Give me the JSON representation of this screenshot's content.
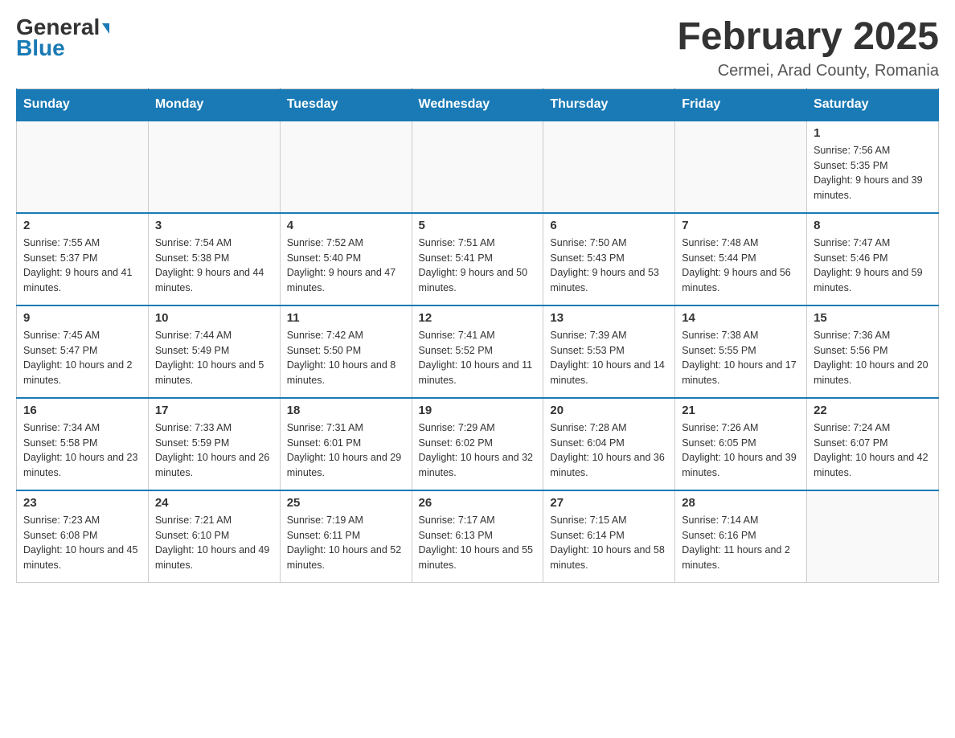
{
  "logo": {
    "general": "General",
    "blue": "Blue"
  },
  "title": {
    "month_year": "February 2025",
    "location": "Cermei, Arad County, Romania"
  },
  "days_of_week": [
    "Sunday",
    "Monday",
    "Tuesday",
    "Wednesday",
    "Thursday",
    "Friday",
    "Saturday"
  ],
  "weeks": [
    [
      {
        "day": "",
        "sunrise": "",
        "sunset": "",
        "daylight": ""
      },
      {
        "day": "",
        "sunrise": "",
        "sunset": "",
        "daylight": ""
      },
      {
        "day": "",
        "sunrise": "",
        "sunset": "",
        "daylight": ""
      },
      {
        "day": "",
        "sunrise": "",
        "sunset": "",
        "daylight": ""
      },
      {
        "day": "",
        "sunrise": "",
        "sunset": "",
        "daylight": ""
      },
      {
        "day": "",
        "sunrise": "",
        "sunset": "",
        "daylight": ""
      },
      {
        "day": "1",
        "sunrise": "Sunrise: 7:56 AM",
        "sunset": "Sunset: 5:35 PM",
        "daylight": "Daylight: 9 hours and 39 minutes."
      }
    ],
    [
      {
        "day": "2",
        "sunrise": "Sunrise: 7:55 AM",
        "sunset": "Sunset: 5:37 PM",
        "daylight": "Daylight: 9 hours and 41 minutes."
      },
      {
        "day": "3",
        "sunrise": "Sunrise: 7:54 AM",
        "sunset": "Sunset: 5:38 PM",
        "daylight": "Daylight: 9 hours and 44 minutes."
      },
      {
        "day": "4",
        "sunrise": "Sunrise: 7:52 AM",
        "sunset": "Sunset: 5:40 PM",
        "daylight": "Daylight: 9 hours and 47 minutes."
      },
      {
        "day": "5",
        "sunrise": "Sunrise: 7:51 AM",
        "sunset": "Sunset: 5:41 PM",
        "daylight": "Daylight: 9 hours and 50 minutes."
      },
      {
        "day": "6",
        "sunrise": "Sunrise: 7:50 AM",
        "sunset": "Sunset: 5:43 PM",
        "daylight": "Daylight: 9 hours and 53 minutes."
      },
      {
        "day": "7",
        "sunrise": "Sunrise: 7:48 AM",
        "sunset": "Sunset: 5:44 PM",
        "daylight": "Daylight: 9 hours and 56 minutes."
      },
      {
        "day": "8",
        "sunrise": "Sunrise: 7:47 AM",
        "sunset": "Sunset: 5:46 PM",
        "daylight": "Daylight: 9 hours and 59 minutes."
      }
    ],
    [
      {
        "day": "9",
        "sunrise": "Sunrise: 7:45 AM",
        "sunset": "Sunset: 5:47 PM",
        "daylight": "Daylight: 10 hours and 2 minutes."
      },
      {
        "day": "10",
        "sunrise": "Sunrise: 7:44 AM",
        "sunset": "Sunset: 5:49 PM",
        "daylight": "Daylight: 10 hours and 5 minutes."
      },
      {
        "day": "11",
        "sunrise": "Sunrise: 7:42 AM",
        "sunset": "Sunset: 5:50 PM",
        "daylight": "Daylight: 10 hours and 8 minutes."
      },
      {
        "day": "12",
        "sunrise": "Sunrise: 7:41 AM",
        "sunset": "Sunset: 5:52 PM",
        "daylight": "Daylight: 10 hours and 11 minutes."
      },
      {
        "day": "13",
        "sunrise": "Sunrise: 7:39 AM",
        "sunset": "Sunset: 5:53 PM",
        "daylight": "Daylight: 10 hours and 14 minutes."
      },
      {
        "day": "14",
        "sunrise": "Sunrise: 7:38 AM",
        "sunset": "Sunset: 5:55 PM",
        "daylight": "Daylight: 10 hours and 17 minutes."
      },
      {
        "day": "15",
        "sunrise": "Sunrise: 7:36 AM",
        "sunset": "Sunset: 5:56 PM",
        "daylight": "Daylight: 10 hours and 20 minutes."
      }
    ],
    [
      {
        "day": "16",
        "sunrise": "Sunrise: 7:34 AM",
        "sunset": "Sunset: 5:58 PM",
        "daylight": "Daylight: 10 hours and 23 minutes."
      },
      {
        "day": "17",
        "sunrise": "Sunrise: 7:33 AM",
        "sunset": "Sunset: 5:59 PM",
        "daylight": "Daylight: 10 hours and 26 minutes."
      },
      {
        "day": "18",
        "sunrise": "Sunrise: 7:31 AM",
        "sunset": "Sunset: 6:01 PM",
        "daylight": "Daylight: 10 hours and 29 minutes."
      },
      {
        "day": "19",
        "sunrise": "Sunrise: 7:29 AM",
        "sunset": "Sunset: 6:02 PM",
        "daylight": "Daylight: 10 hours and 32 minutes."
      },
      {
        "day": "20",
        "sunrise": "Sunrise: 7:28 AM",
        "sunset": "Sunset: 6:04 PM",
        "daylight": "Daylight: 10 hours and 36 minutes."
      },
      {
        "day": "21",
        "sunrise": "Sunrise: 7:26 AM",
        "sunset": "Sunset: 6:05 PM",
        "daylight": "Daylight: 10 hours and 39 minutes."
      },
      {
        "day": "22",
        "sunrise": "Sunrise: 7:24 AM",
        "sunset": "Sunset: 6:07 PM",
        "daylight": "Daylight: 10 hours and 42 minutes."
      }
    ],
    [
      {
        "day": "23",
        "sunrise": "Sunrise: 7:23 AM",
        "sunset": "Sunset: 6:08 PM",
        "daylight": "Daylight: 10 hours and 45 minutes."
      },
      {
        "day": "24",
        "sunrise": "Sunrise: 7:21 AM",
        "sunset": "Sunset: 6:10 PM",
        "daylight": "Daylight: 10 hours and 49 minutes."
      },
      {
        "day": "25",
        "sunrise": "Sunrise: 7:19 AM",
        "sunset": "Sunset: 6:11 PM",
        "daylight": "Daylight: 10 hours and 52 minutes."
      },
      {
        "day": "26",
        "sunrise": "Sunrise: 7:17 AM",
        "sunset": "Sunset: 6:13 PM",
        "daylight": "Daylight: 10 hours and 55 minutes."
      },
      {
        "day": "27",
        "sunrise": "Sunrise: 7:15 AM",
        "sunset": "Sunset: 6:14 PM",
        "daylight": "Daylight: 10 hours and 58 minutes."
      },
      {
        "day": "28",
        "sunrise": "Sunrise: 7:14 AM",
        "sunset": "Sunset: 6:16 PM",
        "daylight": "Daylight: 11 hours and 2 minutes."
      },
      {
        "day": "",
        "sunrise": "",
        "sunset": "",
        "daylight": ""
      }
    ]
  ]
}
